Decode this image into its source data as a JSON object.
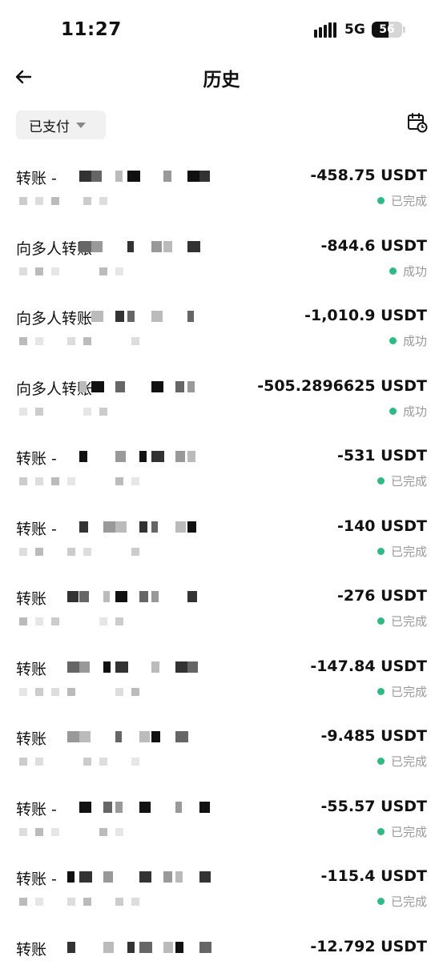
{
  "status_bar": {
    "time": "11:27",
    "network": "5G",
    "battery": "56",
    "battery_level": 0.56
  },
  "header": {
    "title": "历史"
  },
  "filter": {
    "label": "已支付"
  },
  "colors": {
    "status_dot": "#2bbb84",
    "status_text": "#9a9a9a"
  },
  "transactions": [
    {
      "title": "转账 -",
      "amount": "-458.75 USDT",
      "status": "已完成"
    },
    {
      "title": "向多人转账",
      "amount": "-844.6 USDT",
      "status": "成功"
    },
    {
      "title": "向多人转账",
      "amount": "-1,010.9 USDT",
      "status": "成功"
    },
    {
      "title": "向多人转账",
      "amount": "-505.2896625 USDT",
      "status": "成功"
    },
    {
      "title": "转账 -",
      "amount": "-531 USDT",
      "status": "已完成"
    },
    {
      "title": "转账 -",
      "amount": "-140 USDT",
      "status": "已完成"
    },
    {
      "title": "转账",
      "amount": "-276 USDT",
      "status": "已完成"
    },
    {
      "title": "转账",
      "amount": "-147.84 USDT",
      "status": "已完成"
    },
    {
      "title": "转账",
      "amount": "-9.485 USDT",
      "status": "已完成"
    },
    {
      "title": "转账 -",
      "amount": "-55.57 USDT",
      "status": "已完成"
    },
    {
      "title": "转账 -",
      "amount": "-115.4 USDT",
      "status": "已完成"
    },
    {
      "title": "转账",
      "amount": "-12.792 USDT",
      "status": ""
    }
  ]
}
